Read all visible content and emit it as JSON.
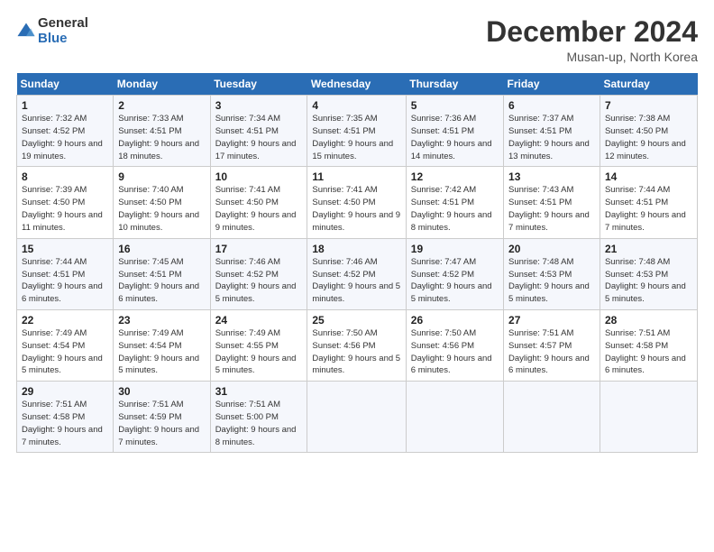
{
  "logo": {
    "general": "General",
    "blue": "Blue"
  },
  "header": {
    "month": "December 2024",
    "location": "Musan-up, North Korea"
  },
  "weekdays": [
    "Sunday",
    "Monday",
    "Tuesday",
    "Wednesday",
    "Thursday",
    "Friday",
    "Saturday"
  ],
  "weeks": [
    [
      {
        "day": "1",
        "sunrise": "Sunrise: 7:32 AM",
        "sunset": "Sunset: 4:52 PM",
        "daylight": "Daylight: 9 hours and 19 minutes."
      },
      {
        "day": "2",
        "sunrise": "Sunrise: 7:33 AM",
        "sunset": "Sunset: 4:51 PM",
        "daylight": "Daylight: 9 hours and 18 minutes."
      },
      {
        "day": "3",
        "sunrise": "Sunrise: 7:34 AM",
        "sunset": "Sunset: 4:51 PM",
        "daylight": "Daylight: 9 hours and 17 minutes."
      },
      {
        "day": "4",
        "sunrise": "Sunrise: 7:35 AM",
        "sunset": "Sunset: 4:51 PM",
        "daylight": "Daylight: 9 hours and 15 minutes."
      },
      {
        "day": "5",
        "sunrise": "Sunrise: 7:36 AM",
        "sunset": "Sunset: 4:51 PM",
        "daylight": "Daylight: 9 hours and 14 minutes."
      },
      {
        "day": "6",
        "sunrise": "Sunrise: 7:37 AM",
        "sunset": "Sunset: 4:51 PM",
        "daylight": "Daylight: 9 hours and 13 minutes."
      },
      {
        "day": "7",
        "sunrise": "Sunrise: 7:38 AM",
        "sunset": "Sunset: 4:50 PM",
        "daylight": "Daylight: 9 hours and 12 minutes."
      }
    ],
    [
      {
        "day": "8",
        "sunrise": "Sunrise: 7:39 AM",
        "sunset": "Sunset: 4:50 PM",
        "daylight": "Daylight: 9 hours and 11 minutes."
      },
      {
        "day": "9",
        "sunrise": "Sunrise: 7:40 AM",
        "sunset": "Sunset: 4:50 PM",
        "daylight": "Daylight: 9 hours and 10 minutes."
      },
      {
        "day": "10",
        "sunrise": "Sunrise: 7:41 AM",
        "sunset": "Sunset: 4:50 PM",
        "daylight": "Daylight: 9 hours and 9 minutes."
      },
      {
        "day": "11",
        "sunrise": "Sunrise: 7:41 AM",
        "sunset": "Sunset: 4:50 PM",
        "daylight": "Daylight: 9 hours and 9 minutes."
      },
      {
        "day": "12",
        "sunrise": "Sunrise: 7:42 AM",
        "sunset": "Sunset: 4:51 PM",
        "daylight": "Daylight: 9 hours and 8 minutes."
      },
      {
        "day": "13",
        "sunrise": "Sunrise: 7:43 AM",
        "sunset": "Sunset: 4:51 PM",
        "daylight": "Daylight: 9 hours and 7 minutes."
      },
      {
        "day": "14",
        "sunrise": "Sunrise: 7:44 AM",
        "sunset": "Sunset: 4:51 PM",
        "daylight": "Daylight: 9 hours and 7 minutes."
      }
    ],
    [
      {
        "day": "15",
        "sunrise": "Sunrise: 7:44 AM",
        "sunset": "Sunset: 4:51 PM",
        "daylight": "Daylight: 9 hours and 6 minutes."
      },
      {
        "day": "16",
        "sunrise": "Sunrise: 7:45 AM",
        "sunset": "Sunset: 4:51 PM",
        "daylight": "Daylight: 9 hours and 6 minutes."
      },
      {
        "day": "17",
        "sunrise": "Sunrise: 7:46 AM",
        "sunset": "Sunset: 4:52 PM",
        "daylight": "Daylight: 9 hours and 5 minutes."
      },
      {
        "day": "18",
        "sunrise": "Sunrise: 7:46 AM",
        "sunset": "Sunset: 4:52 PM",
        "daylight": "Daylight: 9 hours and 5 minutes."
      },
      {
        "day": "19",
        "sunrise": "Sunrise: 7:47 AM",
        "sunset": "Sunset: 4:52 PM",
        "daylight": "Daylight: 9 hours and 5 minutes."
      },
      {
        "day": "20",
        "sunrise": "Sunrise: 7:48 AM",
        "sunset": "Sunset: 4:53 PM",
        "daylight": "Daylight: 9 hours and 5 minutes."
      },
      {
        "day": "21",
        "sunrise": "Sunrise: 7:48 AM",
        "sunset": "Sunset: 4:53 PM",
        "daylight": "Daylight: 9 hours and 5 minutes."
      }
    ],
    [
      {
        "day": "22",
        "sunrise": "Sunrise: 7:49 AM",
        "sunset": "Sunset: 4:54 PM",
        "daylight": "Daylight: 9 hours and 5 minutes."
      },
      {
        "day": "23",
        "sunrise": "Sunrise: 7:49 AM",
        "sunset": "Sunset: 4:54 PM",
        "daylight": "Daylight: 9 hours and 5 minutes."
      },
      {
        "day": "24",
        "sunrise": "Sunrise: 7:49 AM",
        "sunset": "Sunset: 4:55 PM",
        "daylight": "Daylight: 9 hours and 5 minutes."
      },
      {
        "day": "25",
        "sunrise": "Sunrise: 7:50 AM",
        "sunset": "Sunset: 4:56 PM",
        "daylight": "Daylight: 9 hours and 5 minutes."
      },
      {
        "day": "26",
        "sunrise": "Sunrise: 7:50 AM",
        "sunset": "Sunset: 4:56 PM",
        "daylight": "Daylight: 9 hours and 6 minutes."
      },
      {
        "day": "27",
        "sunrise": "Sunrise: 7:51 AM",
        "sunset": "Sunset: 4:57 PM",
        "daylight": "Daylight: 9 hours and 6 minutes."
      },
      {
        "day": "28",
        "sunrise": "Sunrise: 7:51 AM",
        "sunset": "Sunset: 4:58 PM",
        "daylight": "Daylight: 9 hours and 6 minutes."
      }
    ],
    [
      {
        "day": "29",
        "sunrise": "Sunrise: 7:51 AM",
        "sunset": "Sunset: 4:58 PM",
        "daylight": "Daylight: 9 hours and 7 minutes."
      },
      {
        "day": "30",
        "sunrise": "Sunrise: 7:51 AM",
        "sunset": "Sunset: 4:59 PM",
        "daylight": "Daylight: 9 hours and 7 minutes."
      },
      {
        "day": "31",
        "sunrise": "Sunrise: 7:51 AM",
        "sunset": "Sunset: 5:00 PM",
        "daylight": "Daylight: 9 hours and 8 minutes."
      },
      null,
      null,
      null,
      null
    ]
  ]
}
